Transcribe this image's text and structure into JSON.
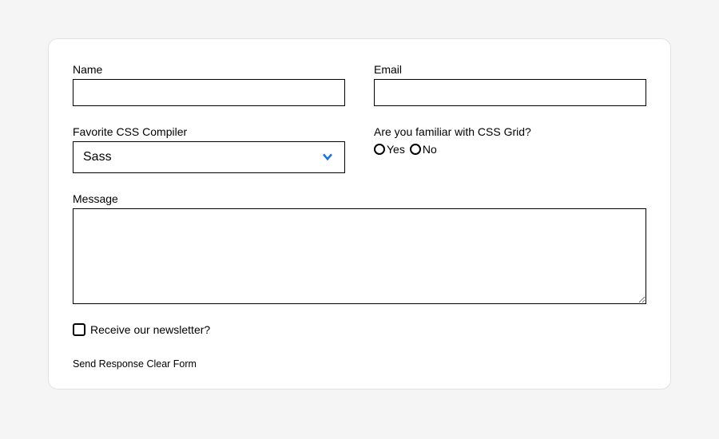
{
  "labels": {
    "name": "Name",
    "email": "Email",
    "compiler": "Favorite CSS Compiler",
    "grid_question": "Are you familiar with CSS Grid?",
    "message": "Message",
    "newsletter": "Receive our newsletter?"
  },
  "values": {
    "name": "",
    "email": "",
    "compiler_selected": "Sass",
    "message": ""
  },
  "radio": {
    "yes": "Yes",
    "no": "No"
  },
  "actions": {
    "send": "Send Response",
    "clear": "Clear Form"
  },
  "colors": {
    "accent": "#1a6fe8"
  }
}
